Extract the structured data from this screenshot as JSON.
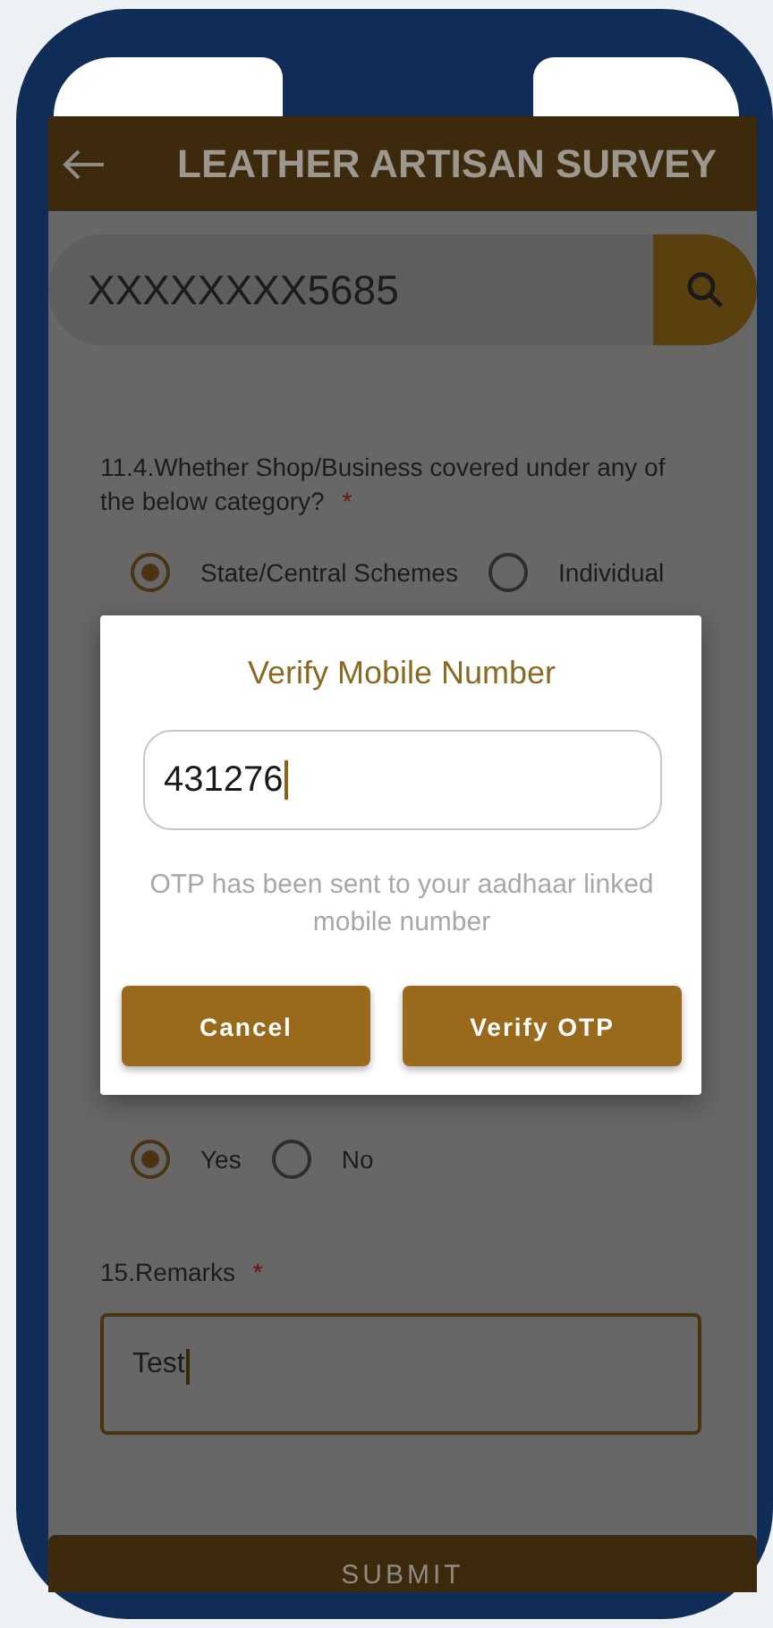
{
  "header": {
    "title": "LEATHER ARTISAN SURVEY"
  },
  "search": {
    "value": "XXXXXXXX5685"
  },
  "questions": [
    {
      "kind": "radio",
      "label": "11.4.Whether Shop/Business covered under any of the below category?",
      "required_mark": "*",
      "options": [
        {
          "label": "State/Central Schemes",
          "selected": true
        },
        {
          "label": "Individual",
          "selected": false
        }
      ]
    },
    {
      "kind": "radio",
      "options": [
        {
          "label": "Yes",
          "selected": true
        },
        {
          "label": "No",
          "selected": false
        }
      ]
    },
    {
      "kind": "text",
      "label": "15.Remarks",
      "required_mark": "*",
      "value": "Test",
      "focused": true
    }
  ],
  "dialog": {
    "title": "Verify Mobile Number",
    "otp": {
      "value": "431276",
      "focused": true
    },
    "message": "OTP has been sent to your aadhaar linked mobile number",
    "buttons": [
      {
        "label": "Cancel"
      },
      {
        "label": "Verify OTP"
      }
    ]
  },
  "submit": {
    "label": "SUBMIT"
  }
}
